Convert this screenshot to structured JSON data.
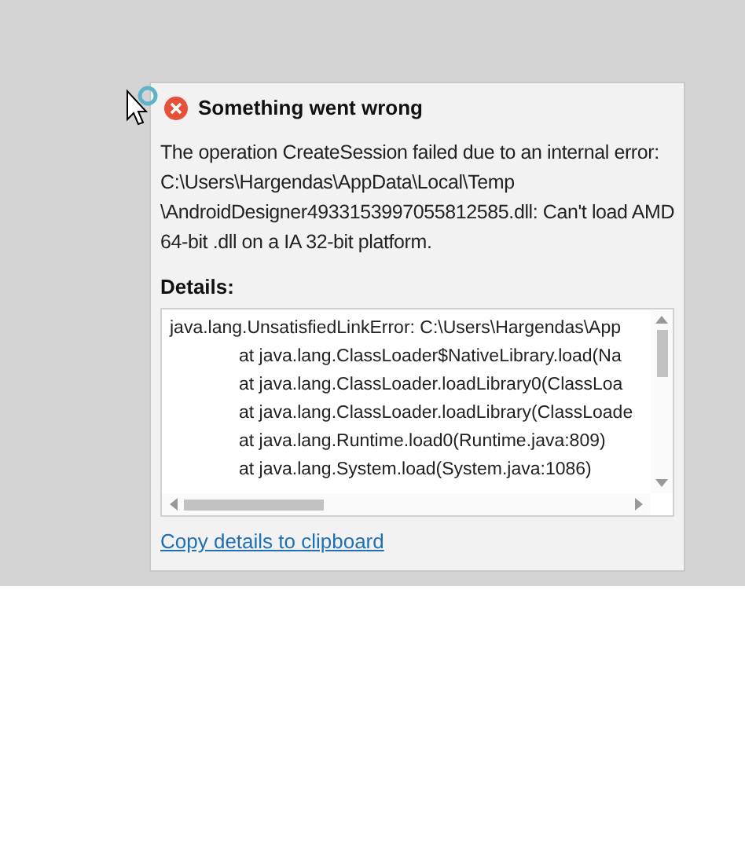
{
  "dialog": {
    "title": "Something went wrong",
    "message": "The operation CreateSession failed due to an internal error: C:\\Users\\Hargendas\\AppData\\Local\\Temp \\AndroidDesigner4933153997055812585.dll: Can't load AMD 64-bit .dll on a IA 32-bit platform.",
    "details_label": "Details:",
    "details_error": "java.lang.UnsatisfiedLinkError: C:\\Users\\Hargendas\\App",
    "details_frames": [
      "at java.lang.ClassLoader$NativeLibrary.load(Na",
      "at java.lang.ClassLoader.loadLibrary0(ClassLoa",
      "at java.lang.ClassLoader.loadLibrary(ClassLoade",
      "at java.lang.Runtime.load0(Runtime.java:809)",
      "at java.lang.System.load(System.java:1086)"
    ],
    "copy_link": "Copy details to clipboard"
  }
}
